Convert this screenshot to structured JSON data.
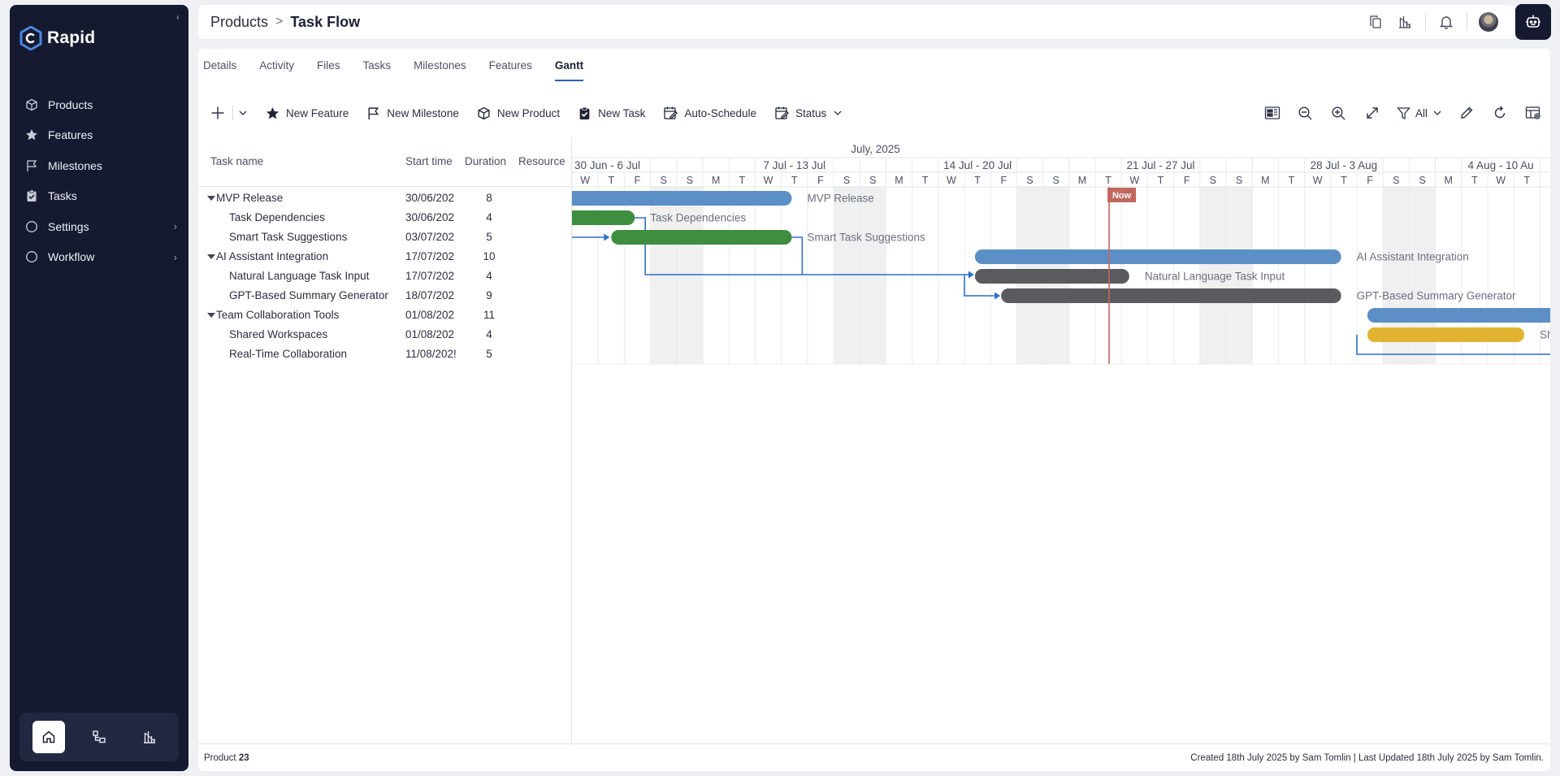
{
  "app": {
    "name": "Rapid"
  },
  "sidebar": {
    "items": [
      {
        "label": "Products",
        "icon": "box-icon",
        "has_submenu": false
      },
      {
        "label": "Features",
        "icon": "star-icon",
        "has_submenu": false
      },
      {
        "label": "Milestones",
        "icon": "flag-icon",
        "has_submenu": false
      },
      {
        "label": "Tasks",
        "icon": "clipboard-check-icon",
        "has_submenu": false
      },
      {
        "label": "Settings",
        "icon": "circle-icon",
        "has_submenu": true
      },
      {
        "label": "Workflow",
        "icon": "circle-icon",
        "has_submenu": true
      }
    ],
    "dock": [
      "home-icon",
      "workflow-icon",
      "chart-icon"
    ]
  },
  "header": {
    "breadcrumb_root": "Products",
    "breadcrumb_separator": ">",
    "breadcrumb_current": "Task Flow"
  },
  "tabs": [
    {
      "label": "Details",
      "active": false
    },
    {
      "label": "Activity",
      "active": false
    },
    {
      "label": "Files",
      "active": false
    },
    {
      "label": "Tasks",
      "active": false
    },
    {
      "label": "Milestones",
      "active": false
    },
    {
      "label": "Features",
      "active": false
    },
    {
      "label": "Gantt",
      "active": true
    }
  ],
  "toolbar": {
    "new_feature": "New Feature",
    "new_milestone": "New Milestone",
    "new_product": "New Product",
    "new_task": "New Task",
    "auto_schedule": "Auto-Schedule",
    "status": "Status",
    "filter_value": "All"
  },
  "grid": {
    "columns": {
      "name": "Task name",
      "start": "Start time",
      "duration": "Duration",
      "resource": "Resource"
    },
    "rows": [
      {
        "name": "MVP Release",
        "start": "30/06/202",
        "duration": "8",
        "parent": true
      },
      {
        "name": "Task Dependencies",
        "start": "30/06/202",
        "duration": "4",
        "parent": false
      },
      {
        "name": "Smart Task Suggestions",
        "start": "03/07/202",
        "duration": "5",
        "parent": false
      },
      {
        "name": "AI Assistant Integration",
        "start": "17/07/202",
        "duration": "10",
        "parent": true
      },
      {
        "name": "Natural Language Task Input",
        "start": "17/07/202",
        "duration": "4",
        "parent": false
      },
      {
        "name": "GPT-Based Summary Generator",
        "start": "18/07/202",
        "duration": "9",
        "parent": false
      },
      {
        "name": "Team Collaboration Tools",
        "start": "01/08/202",
        "duration": "11",
        "parent": true
      },
      {
        "name": "Shared Workspaces",
        "start": "01/08/202",
        "duration": "4",
        "parent": false
      },
      {
        "name": "Real-Time Collaboration",
        "start": "11/08/202!",
        "duration": "5",
        "parent": false
      }
    ]
  },
  "timeline": {
    "month_label": "July, 2025",
    "weeks": [
      "30 Jun - 6 Jul",
      "7 Jul - 13 Jul",
      "14 Jul - 20 Jul",
      "21 Jul - 27 Jul",
      "28 Jul - 3 Aug",
      "4 Aug - 10 Au"
    ],
    "day_letters": [
      "W",
      "T",
      "F",
      "S",
      "S",
      "M",
      "T",
      "W",
      "T",
      "F",
      "S",
      "S",
      "M",
      "T",
      "W",
      "T",
      "F",
      "S",
      "S",
      "M",
      "T",
      "W",
      "T",
      "F",
      "S",
      "S",
      "M",
      "T",
      "W",
      "T",
      "F",
      "S",
      "S",
      "M",
      "T",
      "W",
      "T",
      "F"
    ],
    "now_label": "Now",
    "now_day_index": 20.5,
    "bars": [
      {
        "label": "MVP Release",
        "start_day": -1,
        "end_day": 8.4,
        "color": "#5b8fc5",
        "label_shown": true
      },
      {
        "label": "Task Dependencies",
        "start_day": -1,
        "end_day": 2.4,
        "color": "#3f8d3f",
        "label_shown": true
      },
      {
        "label": "Smart Task Suggestions",
        "start_day": 1.5,
        "end_day": 8.4,
        "color": "#3f8d3f",
        "label_shown": true
      },
      {
        "label": "AI Assistant Integration",
        "start_day": 15.4,
        "end_day": 29.4,
        "color": "#5b8fc5",
        "label_shown": true
      },
      {
        "label": "Natural Language Task Input",
        "start_day": 15.4,
        "end_day": 21.3,
        "color": "#5a5b5e",
        "label_shown": true
      },
      {
        "label": "GPT-Based Summary Generator",
        "start_day": 16.4,
        "end_day": 29.4,
        "color": "#5a5b5e",
        "label_shown": true
      },
      {
        "label": "Team Collaboration Tools",
        "start_day": 30.4,
        "end_day": 38.5,
        "color": "#5b8fc5",
        "label_shown": false
      },
      {
        "label": "Shared Workspaces",
        "start_day": 30.4,
        "end_day": 36.4,
        "color": "#e0b431",
        "label_shown": true,
        "label_display": "Sh"
      }
    ],
    "colors": {
      "weekend": "#f0f0f0",
      "grid": "#e9ebef",
      "link": "#2f6fc4",
      "now": "#c2685f"
    }
  },
  "footer": {
    "product_label": "Product",
    "product_id": "23",
    "audit": "Created 18th July 2025 by Sam Tomlin | Last Updated 18th July 2025 by Sam Tomlin."
  }
}
